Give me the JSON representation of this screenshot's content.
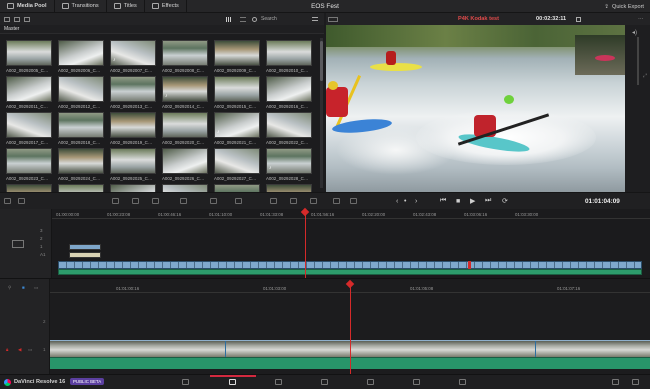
{
  "app_title": "EOS Fest",
  "top_tabs": [
    {
      "label": "Media Pool",
      "icon": "media-pool-icon"
    },
    {
      "label": "Transitions",
      "icon": "transitions-icon"
    },
    {
      "label": "Titles",
      "icon": "titles-icon"
    },
    {
      "label": "Effects",
      "icon": "effects-icon"
    }
  ],
  "quick_export": "Quick Export",
  "media_pool": {
    "search_label": "Search",
    "bin": "Master",
    "clips": [
      "A002_09292005_C…",
      "A002_09292006_C…",
      "A002_09292007_C…",
      "A002_09292008_C…",
      "A002_09292009_C…",
      "A002_09292010_C…",
      "A002_09292011_C…",
      "A002_09292012_C…",
      "A002_09292013_C…",
      "A002_09292014_C…",
      "A002_09292015_C…",
      "A002_09292016_C…",
      "A002_09292017_C…",
      "A002_09292018_C…",
      "A002_09292019_C…",
      "A002_09292020_C…",
      "A002_09292021_C…",
      "A002_09292022_C…",
      "A002_09292023_C…",
      "A002_09292024_C…",
      "A002_09292025_C…",
      "A002_09292026_C…",
      "A002_09292027_C…",
      "A002_09292028_C…",
      "A002_09292029_C…",
      "A002_09292030_C…",
      "A002_09292031_C…",
      "A002_09292032_C…",
      "A002_09292033_C…",
      "A002_09292034_C…"
    ]
  },
  "viewer": {
    "clip_name": "P4K Kodak test",
    "timecode": "00:02:32:11"
  },
  "transport": {
    "timecode": "01:01:04:09"
  },
  "timeline_upper": {
    "ruler": [
      "01:00:00:00",
      "01:00:23:08",
      "01:00:46:16",
      "01:01:10:00",
      "01:01:33:08",
      "01:01:56:16",
      "01:02:20:00",
      "01:02:43:08",
      "01:03:06:16",
      "01:03:30:00"
    ],
    "track_numbers": [
      "3",
      "2",
      "1",
      "A1"
    ]
  },
  "timeline_lower": {
    "ruler": [
      "01:01:00:16",
      "01:01:03:00",
      "01:01:05:08",
      "01:01:07:16"
    ],
    "track_labels": [
      "2",
      "1"
    ]
  },
  "footer": {
    "brand": "DaVinci Resolve 16",
    "beta": "PUBLIC BETA"
  }
}
